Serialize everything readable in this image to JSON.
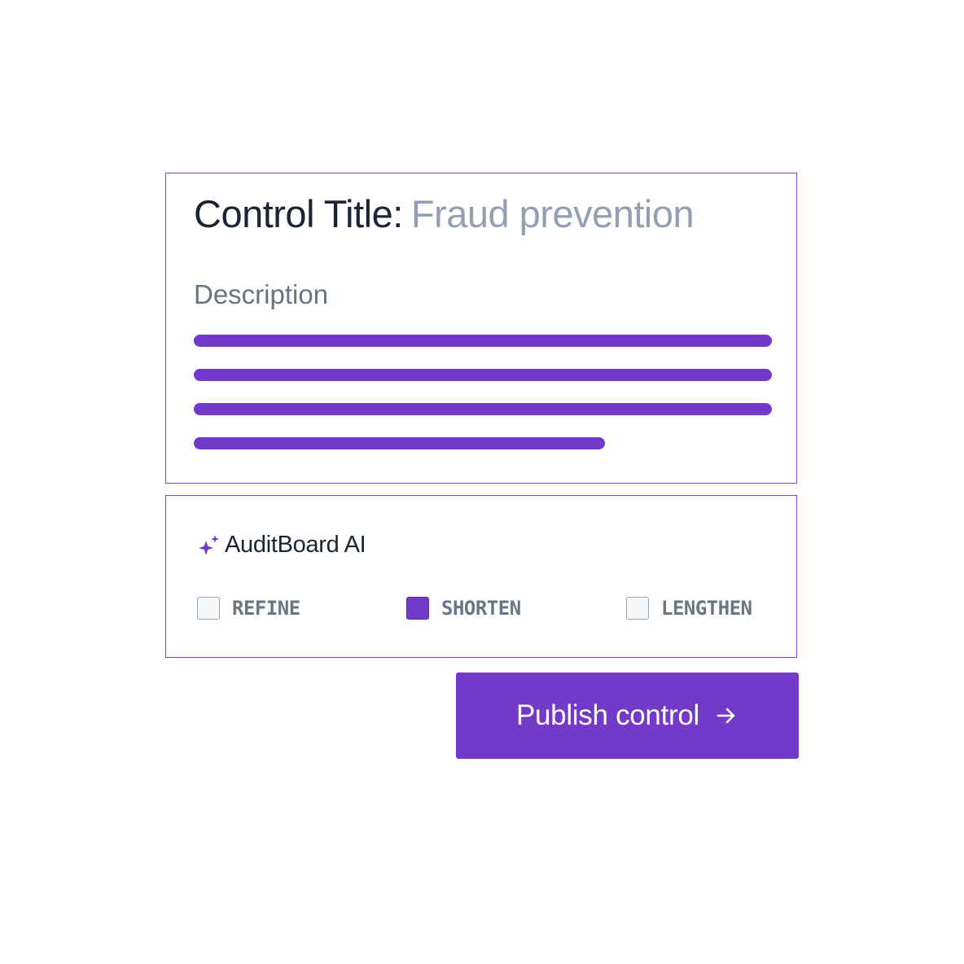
{
  "control": {
    "title_label": "Control Title:",
    "title_value": "Fraud prevention",
    "description_label": "Description"
  },
  "ai_panel": {
    "title": "AuditBoard AI",
    "icon": "sparkle-icon",
    "options": [
      {
        "label": "REFINE",
        "checked": false
      },
      {
        "label": "SHORTEN",
        "checked": true
      },
      {
        "label": "LENGTHEN",
        "checked": false
      }
    ]
  },
  "publish": {
    "label": "Publish control",
    "icon": "arrow-right-icon"
  },
  "colors": {
    "accent": "#7339c8",
    "title_text": "#1c2434",
    "muted_text": "#93a0b3"
  }
}
